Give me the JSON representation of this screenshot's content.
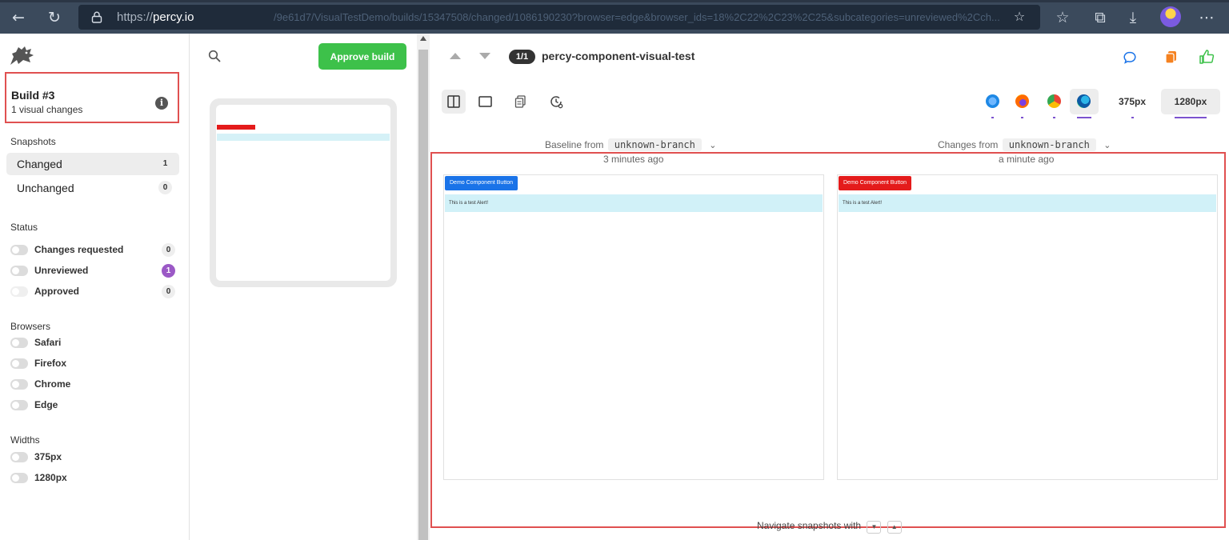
{
  "browser": {
    "url_scheme": "https://",
    "url_host": "percy.io",
    "url_rest": "/9e61d7/VisualTestDemo/builds/15347508/changed/1086190230?browser=edge&browser_ids=18%2C22%2C23%2C25&subcategories=unreviewed%2Cch..."
  },
  "sidebar": {
    "build_title": "Build #3",
    "build_subtitle": "1 visual changes",
    "snapshots_heading": "Snapshots",
    "snapshots": [
      {
        "label": "Changed",
        "count": "1"
      },
      {
        "label": "Unchanged",
        "count": "0"
      }
    ],
    "status_heading": "Status",
    "statuses": [
      {
        "label": "Changes requested",
        "count": "0"
      },
      {
        "label": "Unreviewed",
        "count": "1"
      },
      {
        "label": "Approved",
        "count": "0"
      }
    ],
    "browsers_heading": "Browsers",
    "browsers": [
      "Safari",
      "Firefox",
      "Chrome",
      "Edge"
    ],
    "widths_heading": "Widths",
    "widths": [
      "375px",
      "1280px"
    ]
  },
  "middle": {
    "approve_label": "Approve build"
  },
  "main": {
    "counter": "1/1",
    "snapshot_name": "percy-component-visual-test",
    "width_375": "375px",
    "width_1280": "1280px",
    "baseline_label": "Baseline from",
    "baseline_branch": "unknown-branch",
    "baseline_time": "3 minutes ago",
    "changes_label": "Changes from",
    "changes_branch": "unknown-branch",
    "changes_time": "a minute ago",
    "button_text": "Demo Component Button",
    "alert_text": "This is a test Alert!",
    "nav_hint": "Navigate snapshots with"
  },
  "colors": {
    "accent_purple": "#7b52cf",
    "approve_green": "#3dc14a",
    "highlight_red": "#e05050",
    "baseline_button": "#1a73e8",
    "changed_button": "#e41b1b"
  }
}
